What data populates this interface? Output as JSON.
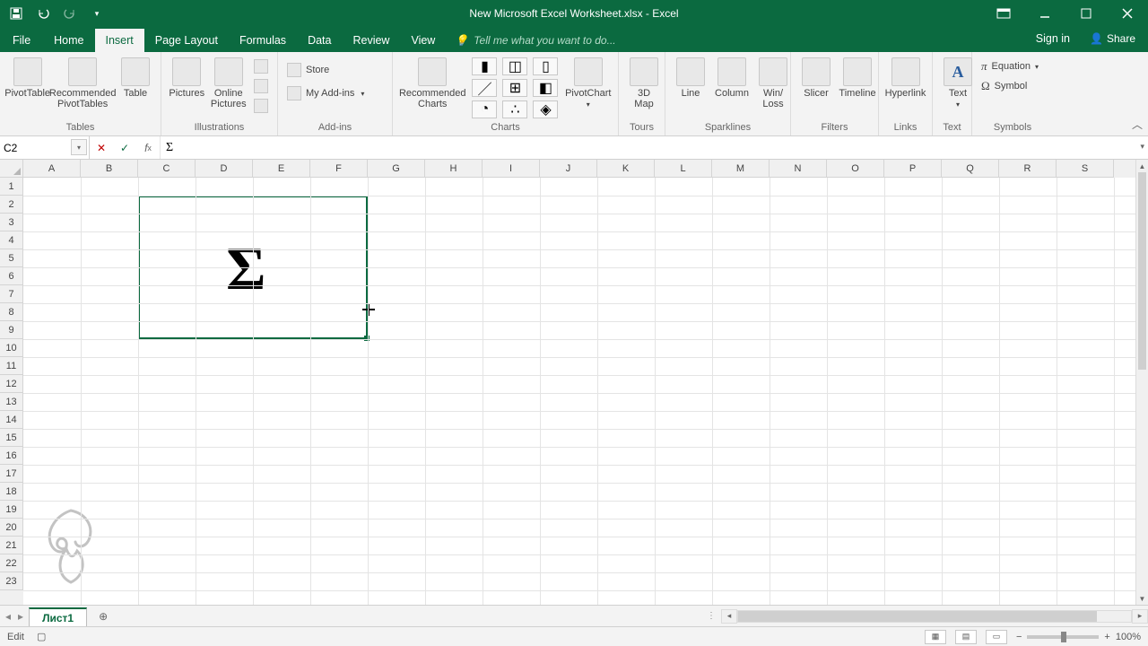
{
  "title": "New Microsoft Excel Worksheet.xlsx - Excel",
  "titlebar": {
    "signin": "Sign in",
    "share": "Share"
  },
  "tabs": {
    "file": "File",
    "items": [
      "Home",
      "Insert",
      "Page Layout",
      "Formulas",
      "Data",
      "Review",
      "View"
    ],
    "active_index": 1,
    "tellme_placeholder": "Tell me what you want to do..."
  },
  "ribbon": {
    "tables": {
      "label": "Tables",
      "pivottable": "PivotTable",
      "recommended_pivot": "Recommended\nPivotTables",
      "table": "Table"
    },
    "illustrations": {
      "label": "Illustrations",
      "pictures": "Pictures",
      "online_pictures": "Online\nPictures"
    },
    "addins": {
      "label": "Add-ins",
      "store": "Store",
      "myaddins": "My Add-ins"
    },
    "charts": {
      "label": "Charts",
      "recommended": "Recommended\nCharts",
      "pivotchart": "PivotChart"
    },
    "tours": {
      "label": "Tours",
      "map3d": "3D\nMap"
    },
    "sparklines": {
      "label": "Sparklines",
      "line": "Line",
      "column": "Column",
      "winloss": "Win/\nLoss"
    },
    "filters": {
      "label": "Filters",
      "slicer": "Slicer",
      "timeline": "Timeline"
    },
    "links": {
      "label": "Links",
      "hyperlink": "Hyperlink"
    },
    "text": {
      "label": "Text",
      "text_btn": "Text"
    },
    "symbols": {
      "label": "Symbols",
      "equation": "Equation",
      "symbol": "Symbol"
    }
  },
  "namebox": "C2",
  "formula_value": "Σ",
  "columns": [
    "A",
    "B",
    "C",
    "D",
    "E",
    "F",
    "G",
    "H",
    "I",
    "J",
    "K",
    "L",
    "M",
    "N",
    "O",
    "P",
    "Q",
    "R",
    "S"
  ],
  "rows": [
    "1",
    "2",
    "3",
    "4",
    "5",
    "6",
    "7",
    "8",
    "9",
    "10",
    "11",
    "12",
    "13",
    "14",
    "15",
    "16",
    "17",
    "18",
    "19",
    "20",
    "21",
    "22",
    "23"
  ],
  "cell_value": "Σ",
  "sheet_tabs": {
    "active": "Лист1"
  },
  "status": {
    "mode": "Edit",
    "zoom": "100%"
  }
}
